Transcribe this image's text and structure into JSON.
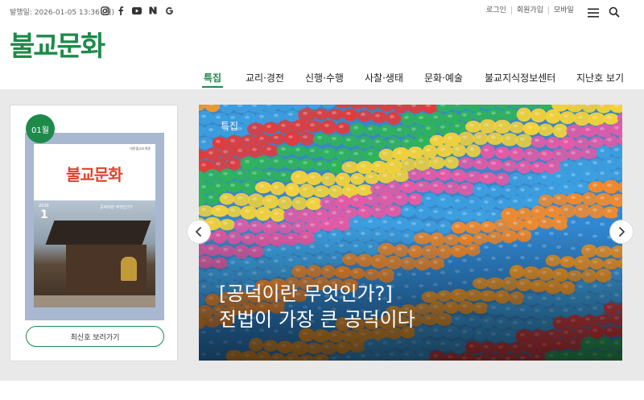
{
  "header": {
    "pubdate": "발행일: 2026-01-05 13:36 (월)",
    "social_icons": [
      "instagram-icon",
      "facebook-icon",
      "youtube-icon",
      "naver-icon",
      "google-icon"
    ],
    "links": [
      "로그인",
      "회원가입",
      "모바일"
    ],
    "logo": "불교문화",
    "brand_color": "#1d8a4a"
  },
  "nav": {
    "items": [
      "특집",
      "교리·경전",
      "신행·수행",
      "사찰·생태",
      "문화·예술",
      "불교지식정보센터",
      "지난호 보기"
    ],
    "active_index": 0
  },
  "issue_card": {
    "badge": "01월",
    "cover": {
      "publisher": "대한불교조계종",
      "title": "불교문화",
      "year": "2026",
      "number": "1",
      "headline": "공덕이란 무엇인가?"
    },
    "button": "최신호 보러가기"
  },
  "hero": {
    "category": "특집",
    "title_line1": "[공덕이란 무엇인가?]",
    "title_line2": "전법이 가장 큰 공덕이다"
  }
}
